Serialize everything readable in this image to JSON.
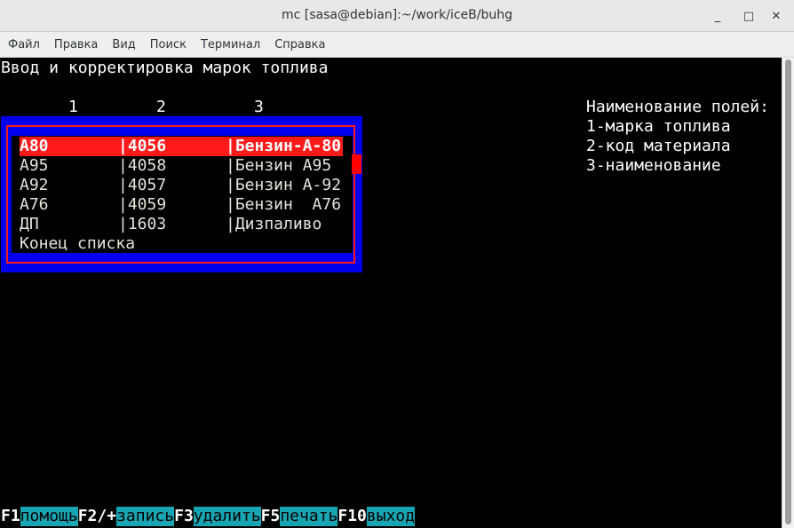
{
  "window": {
    "title": "mc [sasa@debian]:~/work/iceB/buhg",
    "minimize_glyph": "_",
    "maximize_glyph": "□",
    "close_glyph": "✕"
  },
  "menu": [
    "Файл",
    "Правка",
    "Вид",
    "Поиск",
    "Терминал",
    "Справка"
  ],
  "screen": {
    "heading": "Ввод и корректировка марок топлива",
    "column_numbers": [
      "1",
      "2",
      "3"
    ],
    "legend": {
      "title": "Наименование полей:",
      "items": [
        "1-марка топлива",
        "2-код материала",
        "3-наименование"
      ]
    },
    "rows": [
      {
        "mark": "A80",
        "code": "4056",
        "name": "Бензин-А-80",
        "selected": true
      },
      {
        "mark": "A95",
        "code": "4058",
        "name": "Бензин А95",
        "selected": false
      },
      {
        "mark": "A92",
        "code": "4057",
        "name": "Бензин А-92",
        "selected": false
      },
      {
        "mark": "A76",
        "code": "4059",
        "name": "Бензин  А76",
        "selected": false
      },
      {
        "mark": "ДП",
        "code": "1603",
        "name": "Дизпаливо",
        "selected": false
      }
    ],
    "end_of_list": "Конец списка"
  },
  "fkeys": [
    {
      "key": "F1",
      "label": "помощь"
    },
    {
      "key": "F2/+",
      "label": "запись"
    },
    {
      "key": "F3",
      "label": "удалить"
    },
    {
      "key": "F5",
      "label": "печать"
    },
    {
      "key": "F10",
      "label": "выход"
    }
  ],
  "colors": {
    "background": "#000000",
    "frame_blue": "#0000ee",
    "selection_red": "#ff1a1a",
    "fkey_label_bg": "#17a5b3"
  }
}
